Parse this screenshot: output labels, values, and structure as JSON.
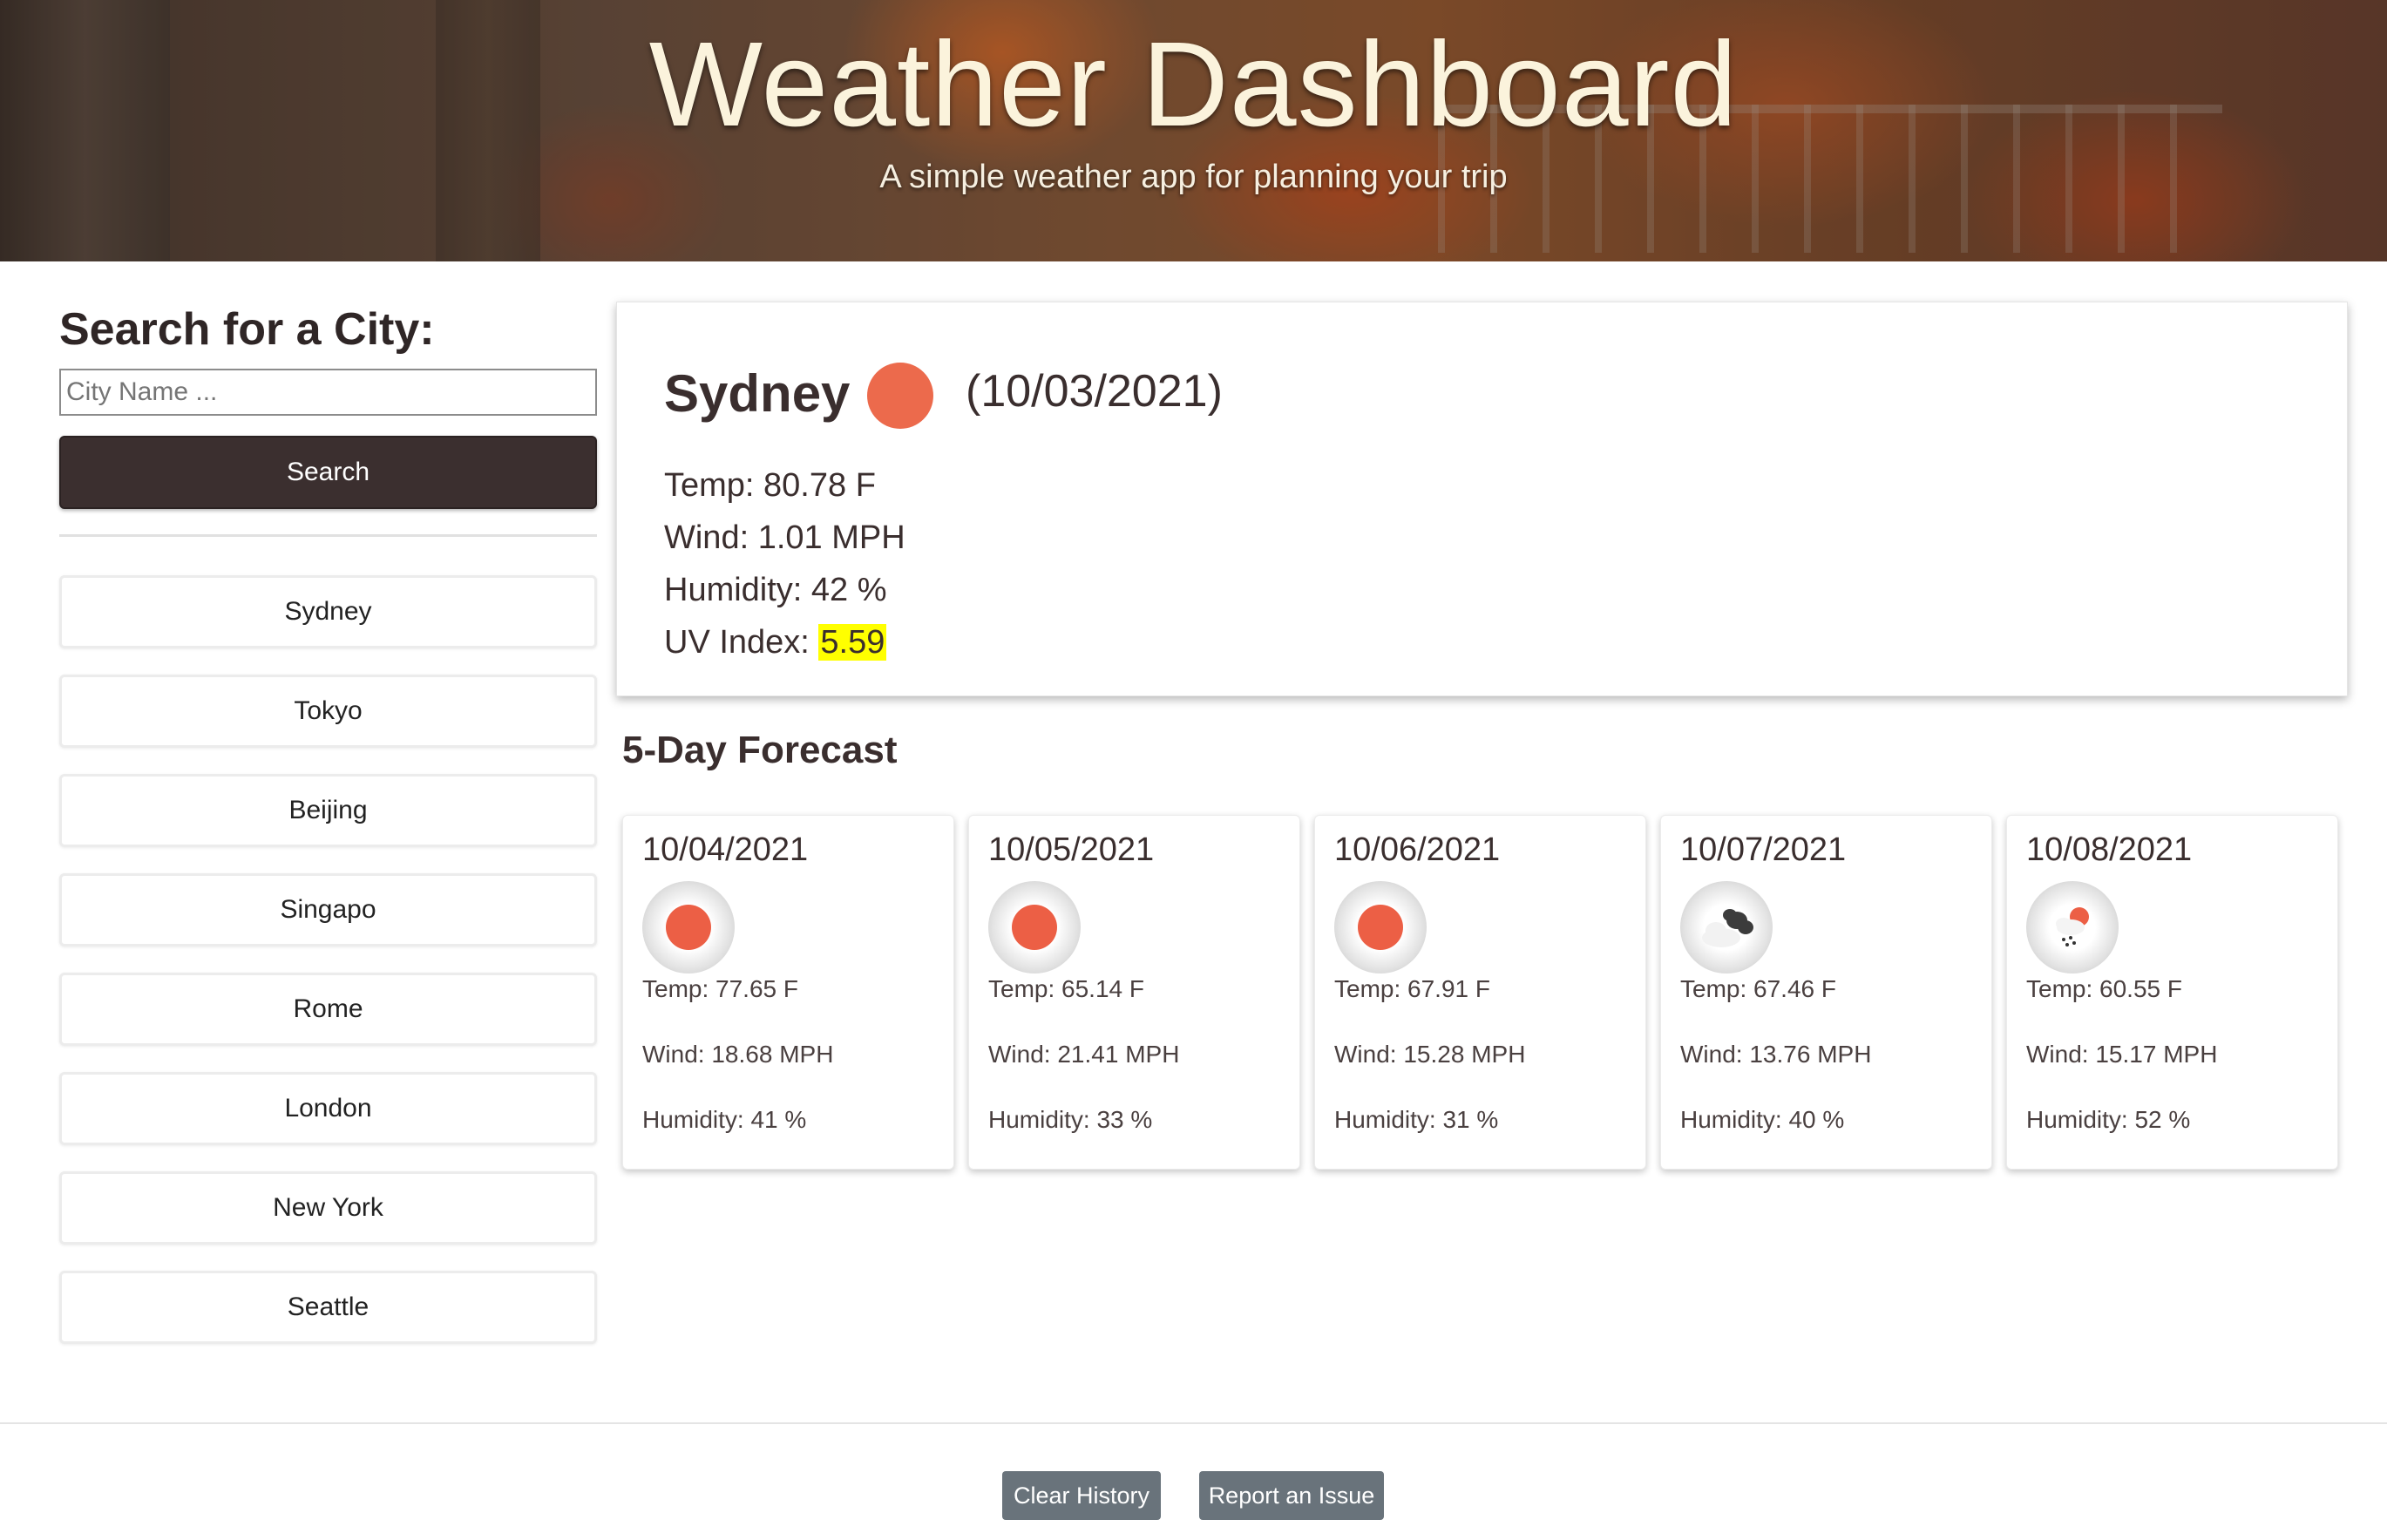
{
  "header": {
    "title": "Weather Dashboard",
    "subtitle": "A simple weather app for planning your trip"
  },
  "sidebar": {
    "heading": "Search for a City:",
    "input_placeholder": "City Name ...",
    "input_value": "",
    "search_label": "Search",
    "history": [
      "Sydney",
      "Tokyo",
      "Beijing",
      "Singapo",
      "Rome",
      "London",
      "New York",
      "Seattle"
    ]
  },
  "current": {
    "city": "Sydney",
    "icon": "clear-sky-icon",
    "date": "(10/03/2021)",
    "temp_label": "Temp: 80.78 F",
    "wind_label": "Wind: 1.01 MPH",
    "humidity_label": "Humidity: 42 %",
    "uv_label": "UV Index: ",
    "uv_value": "5.59",
    "uv_color": "#ffff00"
  },
  "forecast": {
    "heading": "5-Day Forecast",
    "days": [
      {
        "date": "10/04/2021",
        "icon": "clear-sky-icon",
        "temp": "Temp: 77.65 F",
        "wind": "Wind: 18.68 MPH",
        "humidity": "Humidity: 41 %"
      },
      {
        "date": "10/05/2021",
        "icon": "clear-sky-icon",
        "temp": "Temp: 65.14 F",
        "wind": "Wind: 21.41 MPH",
        "humidity": "Humidity: 33 %"
      },
      {
        "date": "10/06/2021",
        "icon": "clear-sky-icon",
        "temp": "Temp: 67.91 F",
        "wind": "Wind: 15.28 MPH",
        "humidity": "Humidity: 31 %"
      },
      {
        "date": "10/07/2021",
        "icon": "broken-clouds-icon",
        "temp": "Temp: 67.46 F",
        "wind": "Wind: 13.76 MPH",
        "humidity": "Humidity: 40 %"
      },
      {
        "date": "10/08/2021",
        "icon": "rain-icon",
        "temp": "Temp: 60.55 F",
        "wind": "Wind: 15.17 MPH",
        "humidity": "Humidity: 52 %"
      }
    ]
  },
  "footer": {
    "clear_label": "Clear History",
    "report_label": "Report an Issue"
  },
  "colors": {
    "sun": "#ec6a4c",
    "dark_button": "#3b2f2f",
    "footer_button": "#69737b"
  }
}
